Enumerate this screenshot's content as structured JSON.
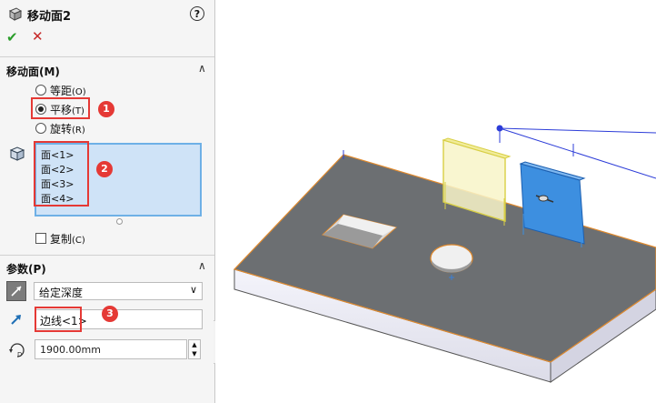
{
  "header": {
    "title": "移动面2",
    "help_icon": "question-icon",
    "help_label": "?",
    "ok_label": "✔",
    "cancel_label": "✕"
  },
  "move_face_section": {
    "title": "移动面(M)",
    "collapse_label": "∧",
    "options": [
      {
        "label": "等距",
        "shortcut": "(O)",
        "selected": false
      },
      {
        "label": "平移",
        "shortcut": "(T)",
        "selected": true
      },
      {
        "label": "旋转",
        "shortcut": "(R)",
        "selected": false
      }
    ],
    "faces": [
      "面<1>",
      "面<2>",
      "面<3>",
      "面<4>"
    ],
    "copy_label": "复制",
    "copy_shortcut": "(C)",
    "copy_checked": false
  },
  "params_section": {
    "title": "参数(P)",
    "collapse_label": "∧",
    "end_condition": "给定深度",
    "dropdown_arrow": "∨",
    "direction_ref": "边线<1>",
    "depth": "1900.00mm",
    "spin_up": "▲",
    "spin_down": "▼"
  },
  "annotations": {
    "badge1": "1",
    "badge2": "2",
    "badge3": "3"
  },
  "colors": {
    "accent_red": "#e53935",
    "list_bg": "#cfe3f7",
    "face_blue": "#3d8fe0",
    "part_gray": "#6c6f72",
    "preview_yellow": "#e6e07a"
  }
}
